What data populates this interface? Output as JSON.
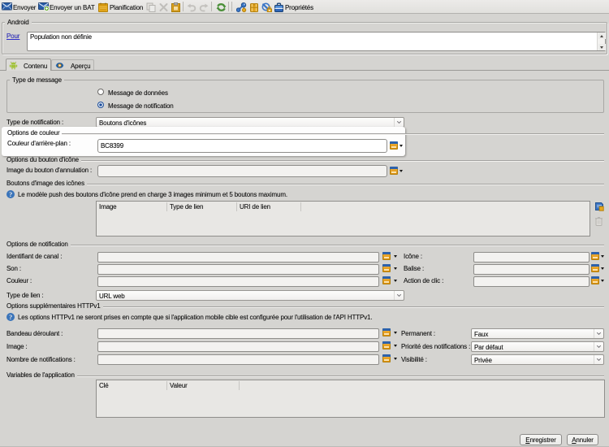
{
  "toolbar": {
    "send": "Envoyer",
    "send_proof": "Envoyer un BAT",
    "schedule": "Planification",
    "properties": "Propriétés",
    "icons": [
      "send-mail-icon",
      "send-proof-icon",
      "schedule-calendar-icon",
      "copy-icon",
      "cut-icon",
      "paste-icon",
      "undo-icon",
      "redo-icon",
      "refresh-icon",
      "link-icon",
      "package-icon",
      "unlock-icon",
      "properties-icon"
    ]
  },
  "android": {
    "legend": "Android",
    "pour_link": "Pour",
    "population": "Population non définie"
  },
  "tabs": [
    {
      "label": "Contenu",
      "icon": "android-icon",
      "selected": true
    },
    {
      "label": "Aperçu",
      "icon": "eye-icon",
      "selected": false
    }
  ],
  "message_type": {
    "legend": "Type de message",
    "options": [
      {
        "label": "Message de données",
        "selected": false
      },
      {
        "label": "Message de notification",
        "selected": true
      }
    ]
  },
  "notification_type": {
    "label": "Type de notification :",
    "value": "Boutons d'icônes"
  },
  "color_options": {
    "legend": "Options de couleur",
    "field_label": "Couleur d'arrière-plan :",
    "value": "BC8399"
  },
  "icon_button_options": {
    "legend": "Options du bouton d'icône",
    "field_label": "Image du bouton d'annulation :"
  },
  "icon_images": {
    "legend": "Boutons d'image des icônes",
    "info": "Le modèle push des boutons d'icône prend en charge 3 images minimum et 5 boutons maximum.",
    "columns": [
      "Image",
      "Type de lien",
      "URI de lien"
    ]
  },
  "notification_options": {
    "legend": "Options de notification",
    "left": [
      "Identifiant de canal :",
      "Son :",
      "Couleur :"
    ],
    "right": [
      "Icône :",
      "Balise :",
      "Action de clic :"
    ],
    "link_type_label": "Type de lien :",
    "link_type_value": "URL web"
  },
  "httpv1": {
    "legend": "Options supplémentaires HTTPv1",
    "info": "Les options HTTPv1 ne seront prises en compte que si l'application mobile cible est configurée pour l'utilisation de l'API HTTPv1.",
    "left": [
      "Bandeau déroulant :",
      "Image :",
      "Nombre de notifications :"
    ],
    "right": [
      {
        "label": "Permanent :",
        "value": "Faux"
      },
      {
        "label": "Priorité des notifications :",
        "value": "Par défaut"
      },
      {
        "label": "Visibilité :",
        "value": "Privée"
      }
    ]
  },
  "variables": {
    "legend": "Variables de l'application",
    "columns": [
      "Clé",
      "Valeur"
    ]
  },
  "footer": {
    "save": "Enregistrer",
    "cancel": "Annuler"
  },
  "colors": {
    "window_bg": "#d5d4d1",
    "accent_blue": "#2e66b8",
    "accent_orange": "#e09a26",
    "link_blue": "#2d2dcb"
  }
}
